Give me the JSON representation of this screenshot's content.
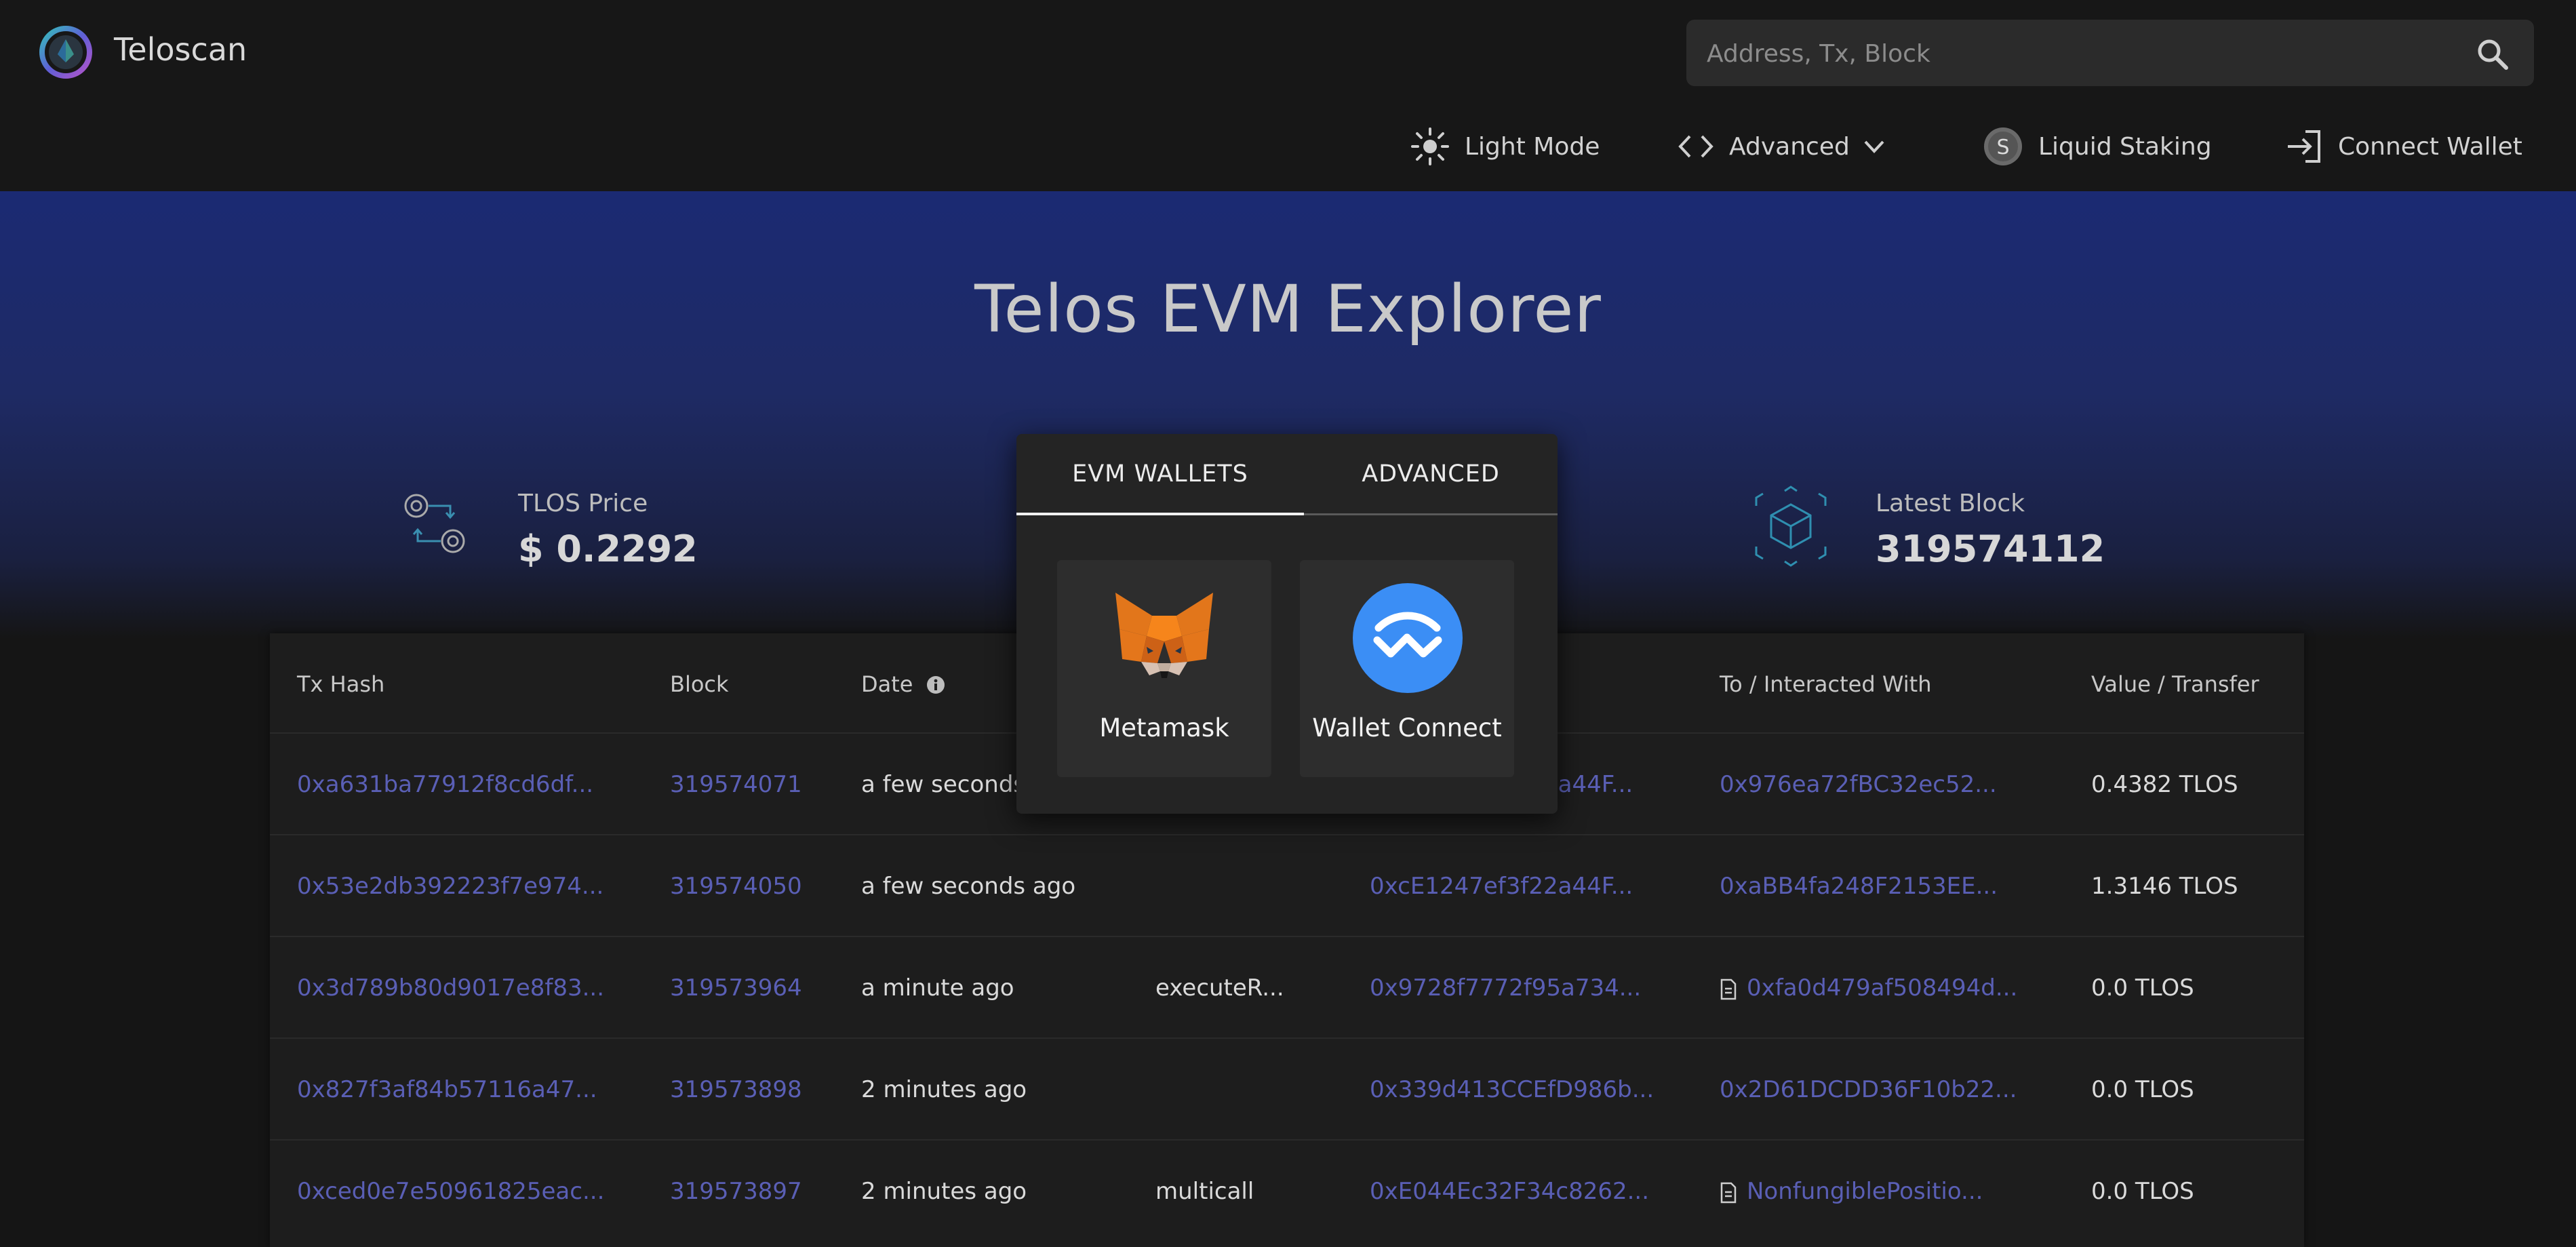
{
  "header": {
    "brand": "Teloscan",
    "search_placeholder": "Address, Tx, Block",
    "nav": {
      "light_mode": "Light Mode",
      "advanced": "Advanced",
      "liquid_staking": "Liquid Staking",
      "staking_badge": "S",
      "connect_wallet": "Connect Wallet"
    }
  },
  "hero": {
    "title": "Telos EVM Explorer",
    "tlos_price_label": "TLOS Price",
    "tlos_price_value": "$ 0.2292",
    "latest_block_label": "Latest Block",
    "latest_block_value": "319574112"
  },
  "table": {
    "headers": {
      "tx_hash": "Tx Hash",
      "block": "Block",
      "date": "Date",
      "to": "To / Interacted With",
      "value": "Value / Transfer"
    },
    "rows": [
      {
        "hash": "0xa631ba77912f8cd6df...",
        "block": "319574071",
        "date": "a few seconds ago",
        "method": "",
        "from": "0xcE1247ef3f22a44F...",
        "to": "0x976ea72fBC32ec52...",
        "to_contract": false,
        "value": "0.4382 TLOS"
      },
      {
        "hash": "0x53e2db392223f7e974...",
        "block": "319574050",
        "date": "a few seconds ago",
        "method": "",
        "from": "0xcE1247ef3f22a44F...",
        "to": "0xaBB4fa248F2153EE...",
        "to_contract": false,
        "value": "1.3146 TLOS"
      },
      {
        "hash": "0x3d789b80d9017e8f83...",
        "block": "319573964",
        "date": "a minute ago",
        "method": "executeR...",
        "from": "0x9728f7772f95a734...",
        "to": "0xfa0d479af508494d...",
        "to_contract": true,
        "value": "0.0 TLOS"
      },
      {
        "hash": "0x827f3af84b57116a47...",
        "block": "319573898",
        "date": "2 minutes ago",
        "method": "",
        "from": "0x339d413CCEfD986b...",
        "to": "0x2D61DCDD36F10b22...",
        "to_contract": false,
        "value": "0.0 TLOS"
      },
      {
        "hash": "0xced0e7e50961825eac...",
        "block": "319573897",
        "date": "2 minutes ago",
        "method": "multicall",
        "from": "0xE044Ec32F34c8262...",
        "to": "NonfungiblePositio...",
        "to_contract": true,
        "value": "0.0 TLOS"
      }
    ]
  },
  "dialog": {
    "tabs": [
      "EVM WALLETS",
      "ADVANCED"
    ],
    "active_tab": 0,
    "wallets": [
      "Metamask",
      "Wallet Connect"
    ]
  },
  "colors": {
    "link": "#5a5fb5",
    "accent_blue": "#3b8ef5",
    "metamask_orange": "#e8821e"
  }
}
